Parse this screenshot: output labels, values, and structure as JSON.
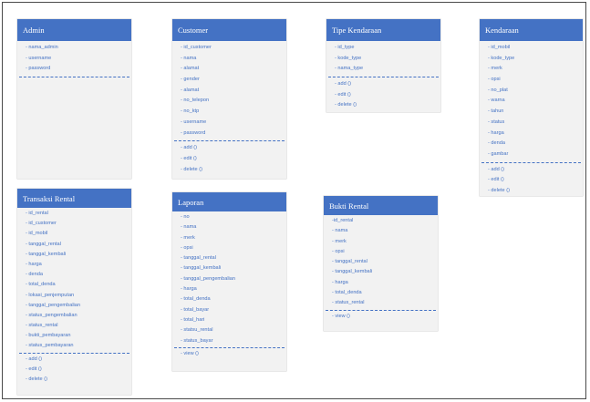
{
  "colors": {
    "header": "#4472c4",
    "body": "#f2f2f2",
    "text": "#4472c4"
  },
  "classes": {
    "admin": {
      "name": "Admin",
      "attributes": [
        "- nama_admin",
        "- username",
        "- password"
      ],
      "methods": []
    },
    "customer": {
      "name": "Customer",
      "attributes": [
        "- id_customer",
        "- nama",
        "- alamat",
        "- gender",
        "- alamat",
        "- no_telepon",
        "- no_ktp",
        "- username",
        "- password"
      ],
      "methods": [
        "- add ()",
        "- edit ()",
        "- delete ()"
      ]
    },
    "tipe_kendaraan": {
      "name": "Tipe Kendaraan",
      "attributes": [
        "- id_type",
        "- kode_type",
        "- nama_type"
      ],
      "methods": [
        "- add ()",
        "- edit ()",
        "- delete ()"
      ]
    },
    "kendaraan": {
      "name": "Kendaraan",
      "attributes": [
        "- id_mobil",
        "- kode_type",
        "- merk",
        "- opsi",
        "- no_plat",
        "- warna",
        "- tahun",
        "- status",
        "- harga",
        "- denda",
        "- gambar"
      ],
      "methods": [
        "- add ()",
        "- edit ()",
        "- delete ()"
      ]
    },
    "transaksi_rental": {
      "name": "Transaksi Rental",
      "attributes": [
        "- id_rental",
        "- id_customer",
        "- id_mobil",
        "- tanggal_rental",
        "- tanggal_kembali",
        "- harga",
        "- denda",
        "- total_denda",
        "- lokasi_penjemputan",
        "- tanggal_pengembalian",
        "- status_pengembalian",
        "- status_rental",
        "- bukti_pembayaran",
        "- status_pembayaran"
      ],
      "methods": [
        "- add ()",
        "- edit ()",
        "- delete ()"
      ]
    },
    "laporan": {
      "name": "Laporan",
      "attributes": [
        "- no",
        "- nama",
        "- merk",
        "- opsi",
        "- tanggal_rental",
        "- tanggal_kembali",
        "- tanggal_pengembalian",
        "- harga",
        "- total_denda",
        "- total_bayar",
        "- total_hari",
        "- statsu_rental",
        "- status_bayar"
      ],
      "methods": [
        "- view ()"
      ]
    },
    "bukti_rental": {
      "name": "Bukti Rental",
      "attributes": [
        "-id_rental",
        "- nama",
        "- merk",
        "- opsi",
        "- tanggal_rental",
        "- tanggal_kembali",
        "- harga",
        "- total_denda",
        "- status_rental"
      ],
      "methods": [
        "- view ()"
      ]
    }
  }
}
